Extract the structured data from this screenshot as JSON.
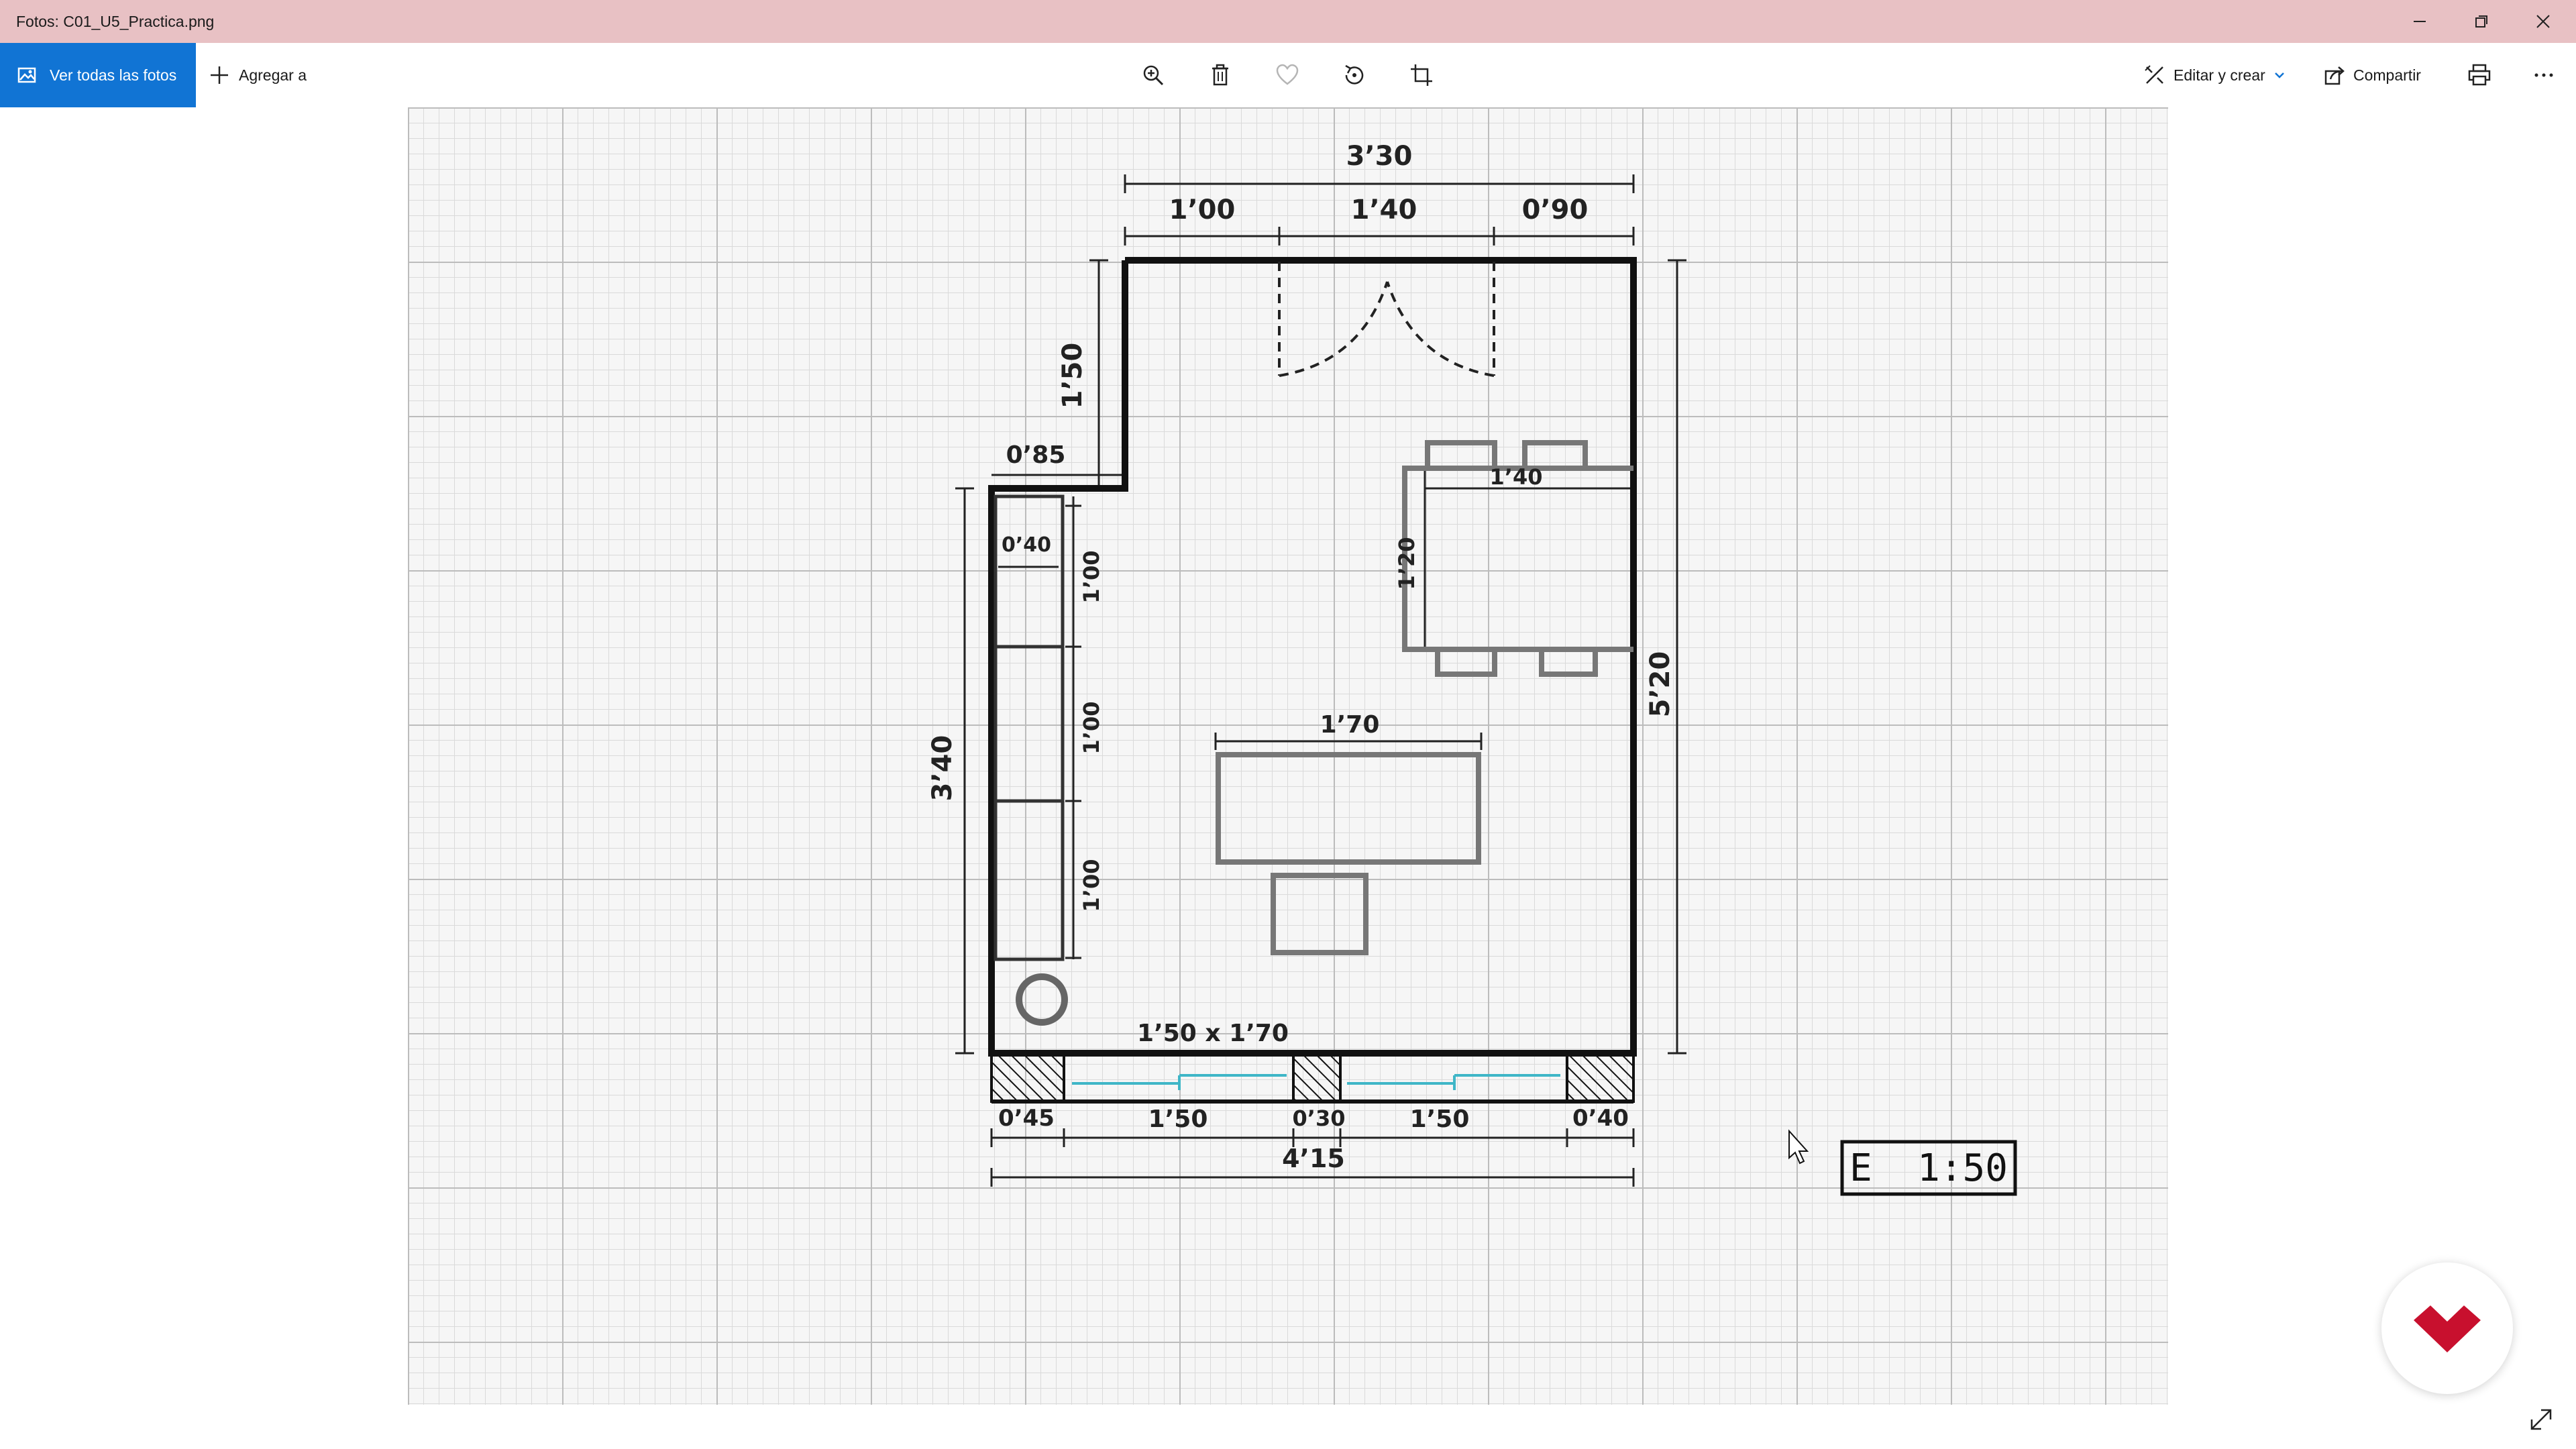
{
  "window": {
    "title": "Fotos: C01_U5_Practica.png"
  },
  "toolbar": {
    "view_all_label": "Ver todas las fotos",
    "add_to_label": "Agregar a",
    "edit_create_label": "Editar y crear",
    "share_label": "Compartir"
  },
  "plan": {
    "dims_top": {
      "total": "3’30",
      "a": "1’00",
      "b": "1’40",
      "c": "0’90"
    },
    "left_upper": "1’50",
    "notch": "0’85",
    "shelf_depth": "0’40",
    "shelf_1": "1’00",
    "shelf_2": "1’00",
    "shelf_3": "1’00",
    "left_total": "3’40",
    "right_total": "5’20",
    "dining_w": "1’40",
    "dining_d": "1’20",
    "desk_w": "1’70",
    "rug": "1’50 x 1’70",
    "bottom": {
      "a": "0’45",
      "b": "1’50",
      "c": "0’30",
      "d": "1’50",
      "e": "0’40",
      "total": "4’15"
    },
    "scale": "E  1:50"
  },
  "colors": {
    "accent": "#1174d4",
    "titlebar": "#e8c1c4",
    "logo": "#c8102e",
    "window_glass": "#3fb6c7"
  }
}
